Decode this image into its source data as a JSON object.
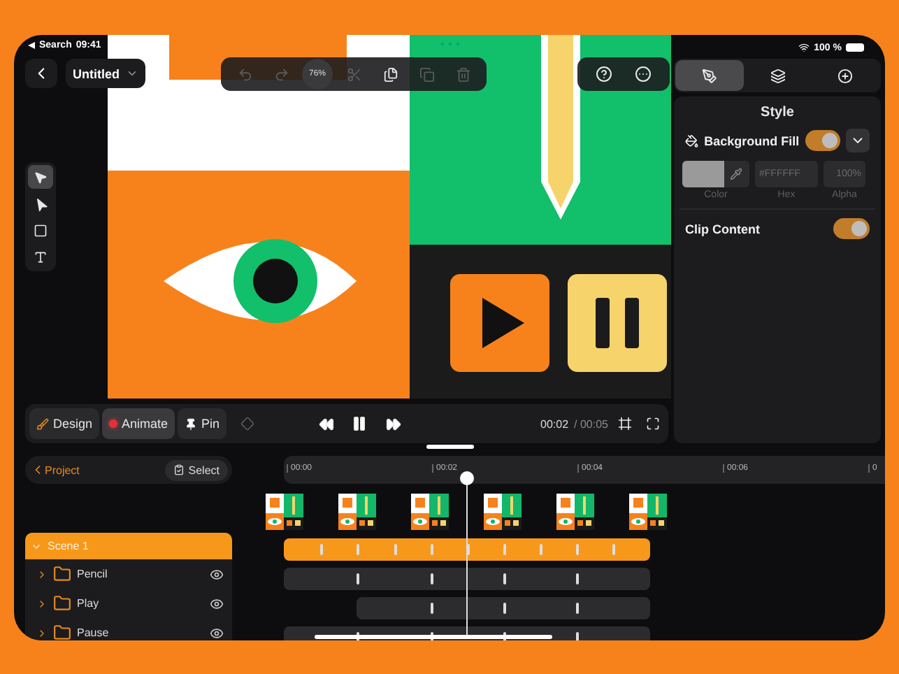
{
  "status_bar": {
    "back_app": "Search",
    "time": "09:41",
    "battery": "100 %"
  },
  "document": {
    "title": "Untitled"
  },
  "edit_toolbar": {
    "zoom": "76%"
  },
  "tools": [
    {
      "kind": "select",
      "selected": true
    },
    {
      "kind": "direct",
      "selected": false
    },
    {
      "kind": "rectangle",
      "selected": false
    },
    {
      "kind": "text",
      "selected": false
    }
  ],
  "inspector_tabs": [
    {
      "kind": "style",
      "selected": true
    },
    {
      "kind": "animation",
      "selected": false
    },
    {
      "kind": "add",
      "selected": false
    }
  ],
  "style_panel": {
    "title": "Style",
    "background_fill": {
      "label": "Background Fill",
      "on": true
    },
    "color": {
      "label": "Color"
    },
    "hex": {
      "placeholder": "#FFFFFF",
      "label": "Hex"
    },
    "alpha": {
      "placeholder": "100%",
      "label": "Alpha"
    },
    "clip_content": {
      "label": "Clip Content",
      "on": true
    }
  },
  "modes": [
    {
      "kind": "design",
      "label": "Design",
      "selected": false
    },
    {
      "kind": "animate",
      "label": "Animate",
      "selected": true
    },
    {
      "kind": "pin",
      "label": "Pin",
      "selected": false
    }
  ],
  "playback": {
    "playing": true,
    "current": "00:02",
    "total": "/ 00:05"
  },
  "layers": {
    "back": "Project",
    "select": "Select",
    "items": [
      {
        "name": "Scene 1",
        "selected": true,
        "expanded": true,
        "children": [
          {
            "name": "Pencil",
            "expanded": false,
            "visible": true
          },
          {
            "name": "Play",
            "expanded": false,
            "visible": true
          },
          {
            "name": "Pause",
            "expanded": false,
            "visible": true
          }
        ]
      }
    ]
  },
  "timeline": {
    "ticks": [
      "00:00",
      "00:02",
      "00:04",
      "00:06",
      "0"
    ]
  }
}
